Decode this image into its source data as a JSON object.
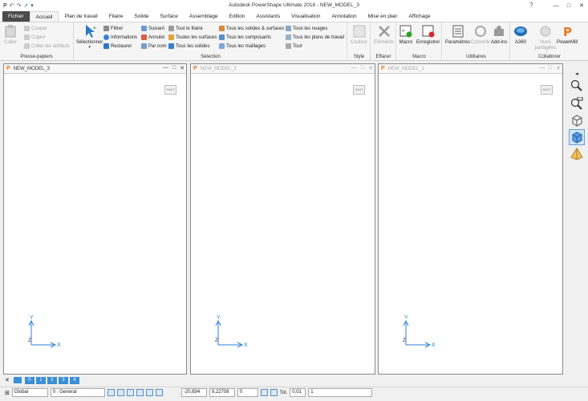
{
  "window": {
    "title": "Autodesk PowerShape Ultimate 2018 - NEW_MODEL_3",
    "app_logo": "P",
    "help": "?",
    "controls": [
      "—",
      "□",
      "✕"
    ]
  },
  "tabs": [
    "Fichier",
    "Accueil",
    "Plan de travail",
    "Filaire",
    "Solide",
    "Surface",
    "Assemblage",
    "Edition",
    "Assistants",
    "Visualisation",
    "Annotation",
    "Mise en plan",
    "Affichage"
  ],
  "ribbon": {
    "clipboard": {
      "label": "Presse-papiers",
      "paste": "Coller",
      "cut": "Couper",
      "copy": "Copier",
      "paste_attributes": "Coller les attributs"
    },
    "selection": {
      "label": "Sélection",
      "select": "Sélectionner",
      "filter": "Filtrer",
      "information": "Informations",
      "restore": "Restaurer",
      "next": "Suivant",
      "cancel": "Annuler",
      "by_name": "Par nom",
      "all_wireframe": "Tout le filaire",
      "all_surfaces": "Toutes les surfaces",
      "all_solids": "Tous les solides",
      "all_solids_surfaces": "Tous les solides & surfaces",
      "all_components": "Tous les composants",
      "all_meshes": "Tous les maillages",
      "all_clouds": "Tous les nuages",
      "all_workplanes": "Tous les plans de travail",
      "all": "Tout"
    },
    "style": {
      "label": "Style",
      "color": "Couleur"
    },
    "erase": {
      "label": "Effacer",
      "elements": "Eléments"
    },
    "macro": {
      "label": "Macro",
      "macro": "Macro",
      "record": "Enregistrer"
    },
    "utilities": {
      "label": "Utilitaires",
      "params": "Paramètres",
      "convert": "Convertir",
      "addins": "Add-ins"
    },
    "collaborate": {
      "label": "Collaborer",
      "a360": "A360",
      "shared_views": "Vues partagées",
      "powermill": "PowerMill"
    }
  },
  "viewports": [
    {
      "name": "NEW_MODEL_3",
      "active": true,
      "cube": "HAUT",
      "axis_x": "X",
      "axis_y": "Y",
      "axis_z": "Z"
    },
    {
      "name": "NEW_MODEL_2",
      "active": false,
      "cube": "HAUT",
      "axis_x": "X",
      "axis_y": "Y",
      "axis_z": "Z"
    },
    {
      "name": "NEW_MODEL_1",
      "active": false,
      "cube": "HAUT",
      "axis_x": "X",
      "axis_y": "Y",
      "axis_z": "Z"
    }
  ],
  "layers": {
    "close": "✕",
    "items": [
      "0",
      "1",
      "2",
      "3",
      "4"
    ]
  },
  "statusbar": {
    "workplane": "Global",
    "level": "0 : General",
    "x": "-20,694",
    "y": "9,22708",
    "z": "0",
    "tol_label": "Tol.",
    "tol_value": "0,01",
    "extra": "1"
  },
  "colors": {
    "accent": "#2b79c2",
    "logo": "#e8761c",
    "file_tab": "#4b4b4b",
    "axis": "#2b7fd6"
  }
}
